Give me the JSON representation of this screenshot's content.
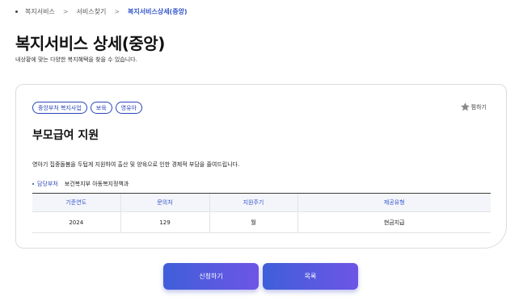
{
  "breadcrumb": {
    "items": [
      "복지서비스",
      "서비스찾기"
    ],
    "current": "복지서비스상세(중앙)"
  },
  "page": {
    "title": "복지서비스 상세(중앙)",
    "description": "내상황에 맞는 다양한 복지혜택을 찾을 수 있습니다."
  },
  "service": {
    "tags": [
      "중앙부처 복지사업",
      "보육",
      "영유아"
    ],
    "bookmark_label": "찜하기",
    "title": "부모급여 지원",
    "description": "영아기 집중돌봄을 두텁게 지원하여 출산 및 양육으로 인한 경제적 부담을 줄여드립니다.",
    "dept_label": "담당부처",
    "dept_value": "보건복지부 아동복지정책과"
  },
  "table": {
    "headers": [
      "기준연도",
      "문의처",
      "지원주기",
      "제공유형"
    ],
    "rows": [
      [
        "2024",
        "129",
        "월",
        "현금지급"
      ]
    ]
  },
  "buttons": {
    "apply": "신청하기",
    "list": "목록"
  },
  "colors": {
    "accent": "#2a45b8",
    "button_gradient_start": "#3f5fd9",
    "button_gradient_end": "#6d55e6",
    "star": "#8a8a8a"
  }
}
